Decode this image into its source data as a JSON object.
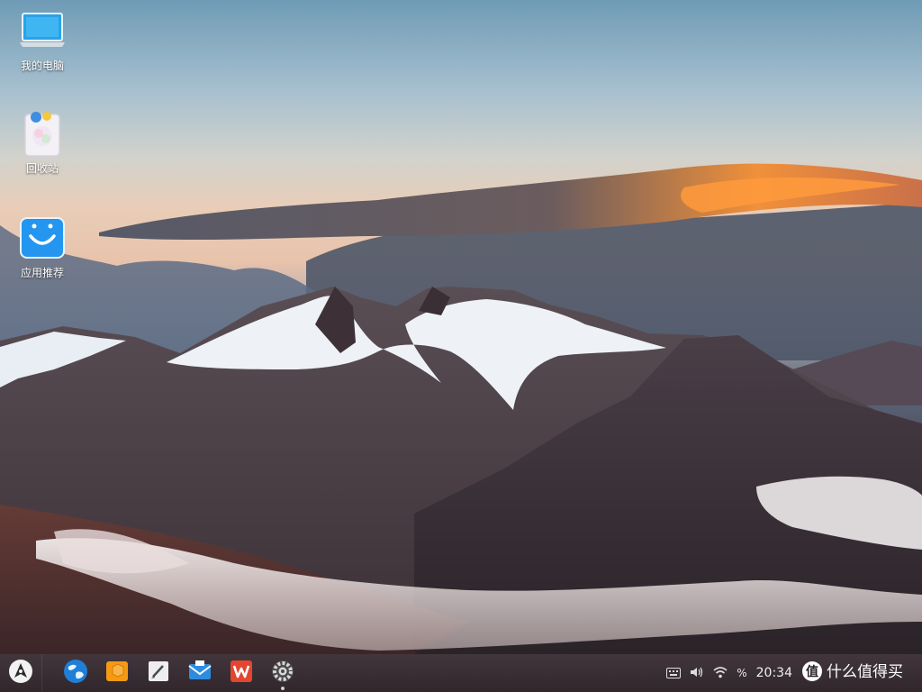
{
  "desktop": {
    "icons": [
      {
        "label": "我的电脑",
        "icon": "computer-icon"
      },
      {
        "label": "回收站",
        "icon": "recycle-bin-icon"
      },
      {
        "label": "应用推荐",
        "icon": "app-store-icon"
      }
    ]
  },
  "taskbar": {
    "start_icon": "start-menu-icon",
    "apps": [
      {
        "name": "browser",
        "icon": "globe-browser-icon",
        "accent": "#1f7fd6"
      },
      {
        "name": "file-manager",
        "icon": "file-manager-icon",
        "accent": "#f59a12"
      },
      {
        "name": "text-editor",
        "icon": "text-editor-icon",
        "accent": "#e8e8e8"
      },
      {
        "name": "mail",
        "icon": "mail-icon",
        "accent": "#2d8ce0"
      },
      {
        "name": "wps-office",
        "icon": "wps-office-icon",
        "accent": "#e4452f"
      },
      {
        "name": "settings",
        "icon": "settings-gear-icon",
        "accent": "#555555"
      }
    ],
    "tray": {
      "keyboard_icon": "keyboard-icon",
      "volume_icon": "volume-icon",
      "wifi_icon": "wifi-icon",
      "battery_text": "%",
      "clock": "20:34",
      "watermark": "值 什么值得买"
    }
  }
}
